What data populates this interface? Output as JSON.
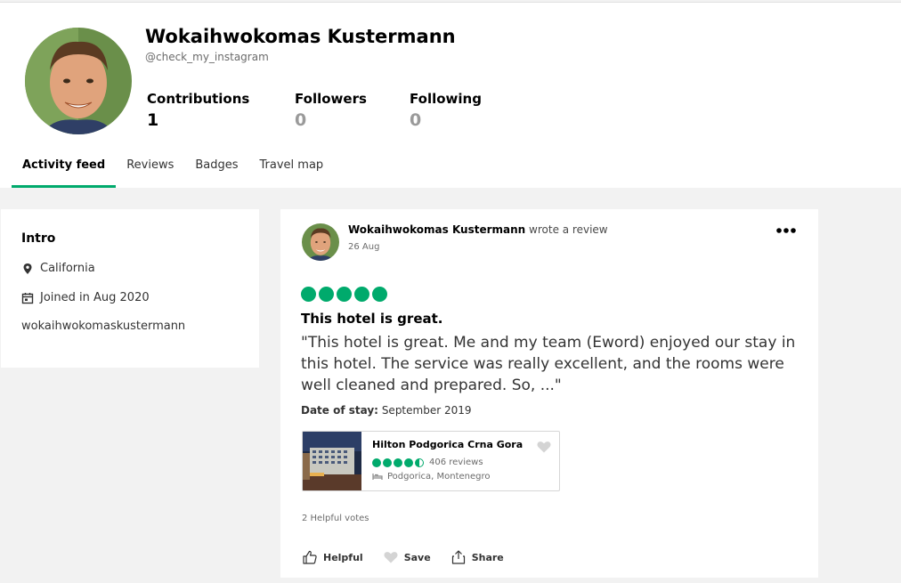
{
  "profile": {
    "name": "Wokaihwokomas Kustermann",
    "handle": "@check_my_instagram",
    "stats": [
      {
        "label": "Contributions",
        "value": "1"
      },
      {
        "label": "Followers",
        "value": "0"
      },
      {
        "label": "Following",
        "value": "0"
      }
    ]
  },
  "tabs": [
    "Activity feed",
    "Reviews",
    "Badges",
    "Travel map"
  ],
  "intro": {
    "title": "Intro",
    "location": "California",
    "joined": "Joined in Aug 2020",
    "username": "wokaihwokomaskustermann"
  },
  "review": {
    "author": "Wokaihwokomas Kustermann",
    "action": "wrote a review",
    "date": "26 Aug",
    "rating": 5,
    "title": "This hotel is great.",
    "text": "\"This hotel is great. Me and my team (Eword) enjoyed our stay in this hotel. The service was really excellent, and the rooms were well cleaned and prepared. So, ...\"",
    "stay_label": "Date of stay:",
    "stay_value": "September 2019",
    "hotel": {
      "name": "Hilton Podgorica Crna Gora",
      "rating": 4.5,
      "reviews": "406 reviews",
      "location": "Podgorica, Montenegro"
    },
    "helpful_votes": "2 Helpful votes",
    "actions": {
      "helpful": "Helpful",
      "save": "Save",
      "share": "Share"
    }
  },
  "colors": {
    "accent": "#00aa6c"
  },
  "icons": [
    "map-pin-icon",
    "calendar-icon",
    "more-icon",
    "heart-icon",
    "bed-icon",
    "thumbs-up-icon",
    "share-icon"
  ]
}
